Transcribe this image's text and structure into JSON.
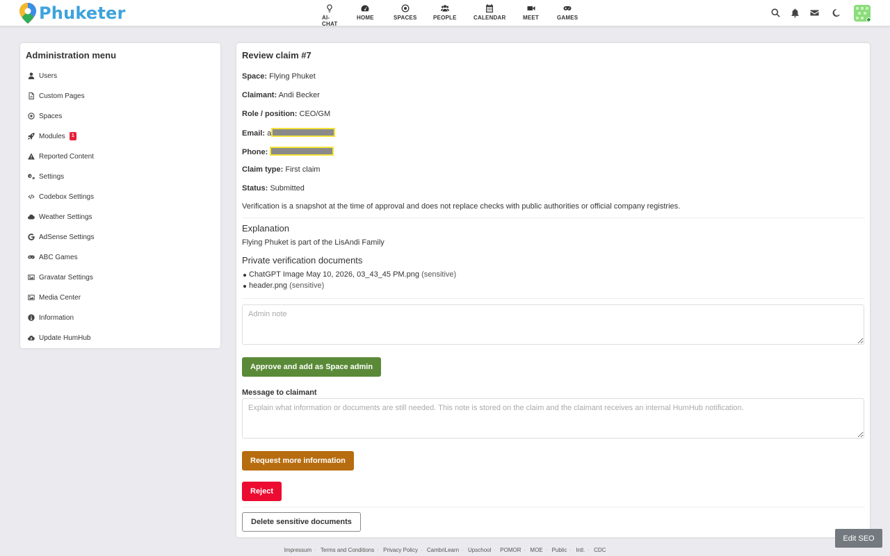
{
  "brand": {
    "name": "Phuketer"
  },
  "nav": [
    {
      "label": "AI-CHAT",
      "icon": "lightbulb-icon"
    },
    {
      "label": "HOME",
      "icon": "dashboard-icon"
    },
    {
      "label": "SPACES",
      "icon": "dot-circle-icon"
    },
    {
      "label": "PEOPLE",
      "icon": "users-icon"
    },
    {
      "label": "CALENDAR",
      "icon": "calendar-icon"
    },
    {
      "label": "MEET",
      "icon": "video-icon"
    },
    {
      "label": "GAMES",
      "icon": "gamepad-icon"
    }
  ],
  "topRight": [
    "search-icon",
    "bell-icon",
    "envelope-icon",
    "moon-icon",
    "avatar"
  ],
  "sidebar": {
    "title": "Administration menu",
    "items": [
      {
        "label": "Users",
        "icon": "user-icon"
      },
      {
        "label": "Custom Pages",
        "icon": "file-icon"
      },
      {
        "label": "Spaces",
        "icon": "dot-circle-icon"
      },
      {
        "label": "Modules",
        "icon": "rocket-icon",
        "badge": "1"
      },
      {
        "label": "Reported Content",
        "icon": "warning-icon"
      },
      {
        "label": "Settings",
        "icon": "cogs-icon"
      },
      {
        "label": "Codebox Settings",
        "icon": "code-icon"
      },
      {
        "label": "Weather Settings",
        "icon": "cloud-icon"
      },
      {
        "label": "AdSense Settings",
        "icon": "google-icon"
      },
      {
        "label": "ABC Games",
        "icon": "gamepad-icon"
      },
      {
        "label": "Gravatar Settings",
        "icon": "image-icon"
      },
      {
        "label": "Media Center",
        "icon": "image-icon"
      },
      {
        "label": "Information",
        "icon": "info-icon"
      },
      {
        "label": "Update HumHub",
        "icon": "cloud-download-icon"
      }
    ]
  },
  "review": {
    "title": "Review claim #7",
    "space_label": "Space:",
    "space": "Flying Phuket",
    "claimant_label": "Claimant:",
    "claimant": "Andi Becker",
    "role_label": "Role / position:",
    "role": "CEO/GM",
    "email_label": "Email:",
    "email_prefix": "a",
    "phone_label": "Phone:",
    "type_label": "Claim type:",
    "type": "First claim",
    "status_label": "Status:",
    "status": "Submitted",
    "disclaimer": "Verification is a snapshot at the time of approval and does not replace checks with public authorities or official company registries.",
    "explanation_title": "Explanation",
    "explanation": "Flying Phuket is part of the LisAndi Family",
    "docs_title": "Private verification documents",
    "docs": [
      {
        "name": "ChatGPT Image May 10, 2026, 03_43_45 PM.png",
        "tag": "(sensitive)"
      },
      {
        "name": "header.png",
        "tag": "(sensitive)"
      }
    ],
    "admin_note_placeholder": "Admin note",
    "approve_label": "Approve and add as Space admin",
    "message_label": "Message to claimant",
    "message_placeholder": "Explain what information or documents are still needed. This note is stored on the claim and the claimant receives an internal HumHub notification.",
    "request_label": "Request more information",
    "reject_label": "Reject",
    "delete_label": "Delete sensitive documents"
  },
  "colors": {
    "brand": "#3ea3dc",
    "approve": "#5a8a37",
    "request": "#b76d0f",
    "reject": "#ec0c31",
    "badge": "#e8203a"
  },
  "footer": [
    "Impressum",
    "Terms and Conditions",
    "Privacy Policy",
    "CambriLearn",
    "Upschool",
    "POMOR",
    "MOE",
    "Public",
    "Intl.",
    "CDC"
  ],
  "edit_seo": "Edit SEO"
}
